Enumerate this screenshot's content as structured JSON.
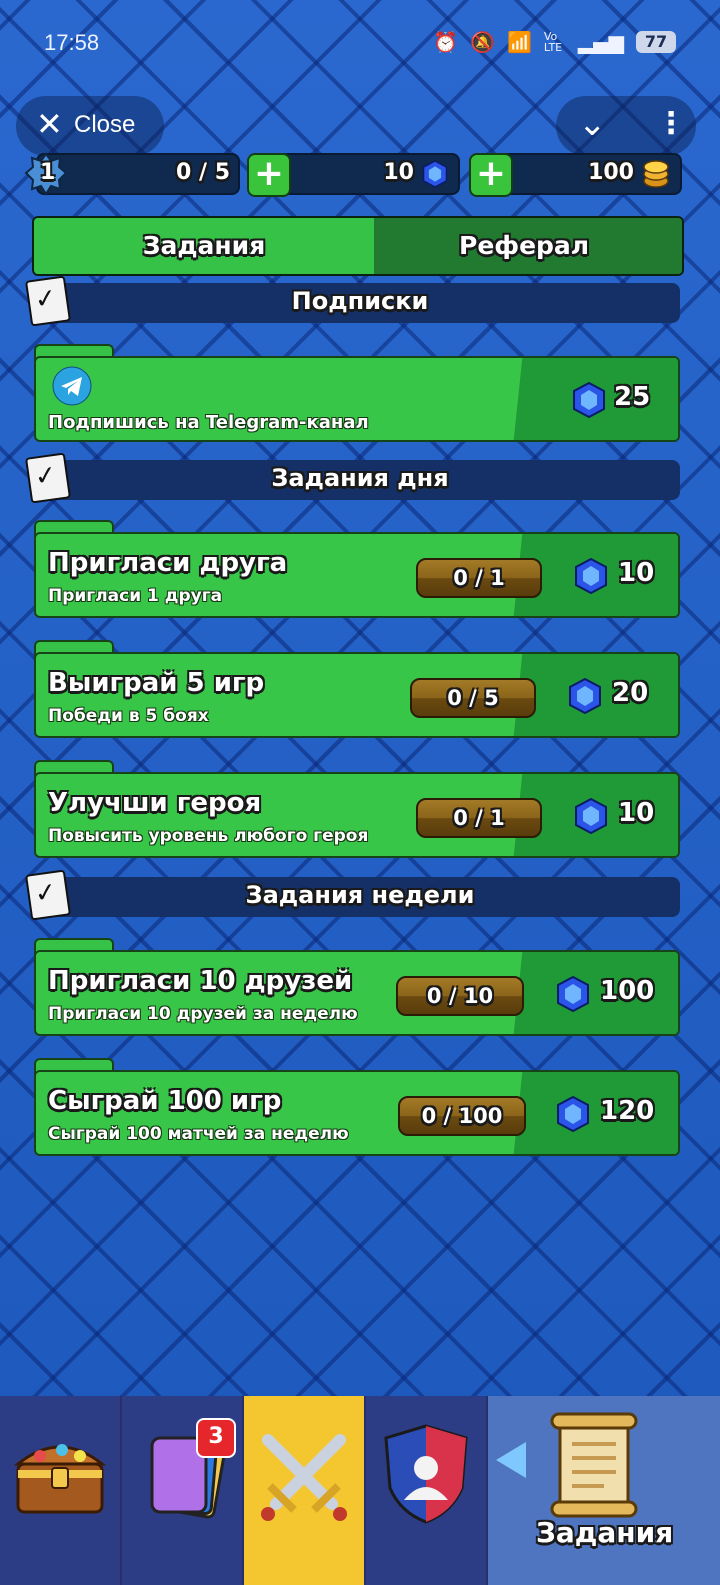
{
  "status_bar": {
    "time": "17:58",
    "battery": "77",
    "network": "Vo LTE"
  },
  "header": {
    "close_label": "Close"
  },
  "resources": {
    "level": "1",
    "xp": "0 / 5",
    "gems": "10",
    "coins": "100"
  },
  "tabs": [
    {
      "label": "Задания",
      "active": true
    },
    {
      "label": "Реферал",
      "active": false
    }
  ],
  "sections": {
    "subscriptions": "Подписки",
    "daily": "Задания дня",
    "weekly": "Задания недели"
  },
  "subscription_task": {
    "subtitle": "Подпишись на Telegram-канал",
    "reward": "25"
  },
  "daily_tasks": [
    {
      "title": "Пригласи друга",
      "subtitle": "Пригласи 1 друга",
      "progress": "0 / 1",
      "reward": "10"
    },
    {
      "title": "Выиграй 5 игр",
      "subtitle": "Победи в 5 боях",
      "progress": "0 / 5",
      "reward": "20"
    },
    {
      "title": "Улучши героя",
      "subtitle": "Повысить уровень любого героя",
      "progress": "0 / 1",
      "reward": "10"
    }
  ],
  "weekly_tasks": [
    {
      "title": "Пригласи 10 друзей",
      "subtitle": "Пригласи 10 друзей за неделю",
      "progress": "0 / 10",
      "reward": "100"
    },
    {
      "title": "Сыграй 100 игр",
      "subtitle": "Сыграй 100 матчей за неделю",
      "progress": "0 / 100",
      "reward": "120"
    }
  ],
  "nav": {
    "cards_badge": "3",
    "tasks_label": "Задания"
  },
  "colors": {
    "bg": "#1f5fc4",
    "card": "#38c649",
    "reward": "#209a36",
    "nav": "#2c3d85",
    "battle": "#f4c731"
  },
  "icons": [
    "close-icon",
    "chevron-down-icon",
    "more-vertical-icon",
    "level-star-icon",
    "gem-icon",
    "coin-icon",
    "plus-icon",
    "checklist-icon",
    "telegram-icon",
    "chest-icon",
    "cards-icon",
    "swords-icon",
    "clan-shield-icon",
    "scroll-icon"
  ]
}
